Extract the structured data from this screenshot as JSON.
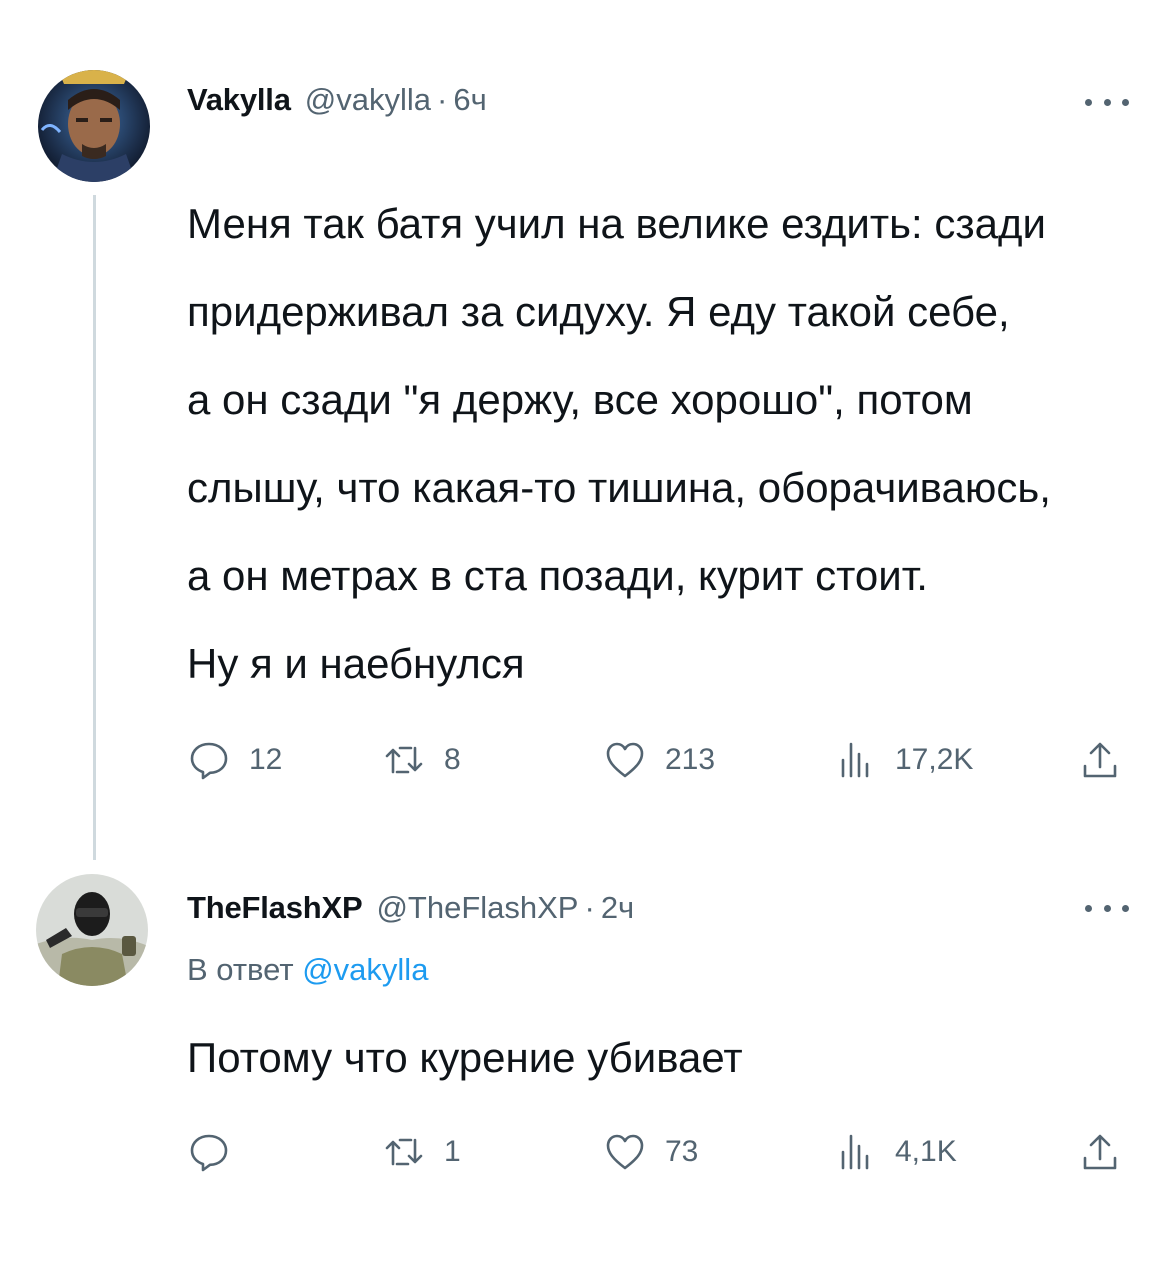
{
  "tweets": [
    {
      "name": "Vakylla",
      "handle": "@vakylla",
      "separator": "·",
      "time": "6ч",
      "body": [
        "Меня так батя учил на велике ездить: сзади",
        "придерживал за сидуху. Я еду такой себе,",
        "а он сзади \"я держу, все хорошо\", потом",
        "слышу, что какая-то тишина, оборачиваюсь,",
        "а он метрах в ста позади, курит стоит.",
        "Ну я и наебнулся"
      ],
      "replies": "12",
      "retweets": "8",
      "likes": "213",
      "views": "17,2K"
    },
    {
      "name": "TheFlashXP",
      "handle": "@TheFlashXP",
      "separator": "·",
      "time": "2ч",
      "reply_prefix": "В ответ",
      "reply_handle": "@vakylla",
      "body": [
        "Потому что курение убивает"
      ],
      "replies": "",
      "retweets": "1",
      "likes": "73",
      "views": "4,1K"
    }
  ],
  "icons": {
    "reply": "reply-bubble-icon",
    "retweet": "retweet-icon",
    "like": "heart-icon",
    "views": "views-bar-chart-icon",
    "share": "share-upload-icon",
    "more": "more-dots-icon"
  },
  "colors": {
    "text": "#0f1419",
    "secondary": "#536471",
    "link": "#1d9bf0",
    "thread_line": "#cfd9de"
  }
}
